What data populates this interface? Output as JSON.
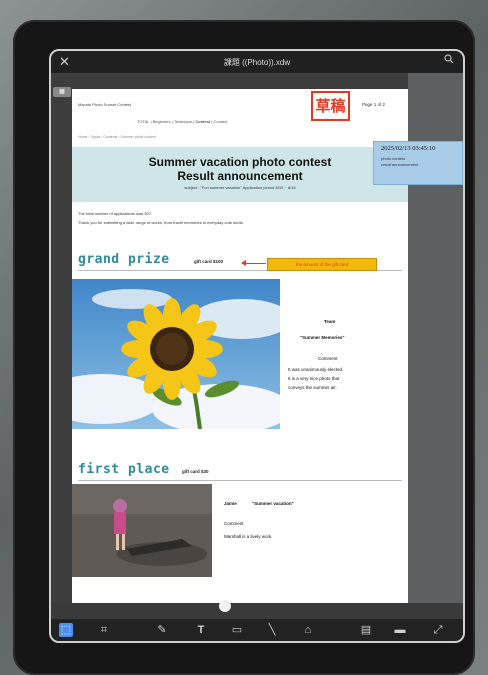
{
  "window": {
    "title": "課題 ((Photo)).xdw"
  },
  "sidebar_tab": "",
  "doc": {
    "header_small": "Macato Photo Sunset Contest",
    "stamp_text": "草稿",
    "page_indicator": "Page 1 of 2",
    "nav": [
      "TOTAL",
      "Beginners",
      "Technique",
      "Contest",
      "Contact"
    ],
    "breadcrumb": "Home › Topics › Contents › Summer photo contest",
    "title_line1": "Summer vacation photo contest",
    "title_line2": "Result announcement",
    "subtitle": "subject : \"Fun summer vacation\" Application period 8/10 ~ 8/15",
    "intro1": "The total number of applications was 307.",
    "intro2": "Thank you for submitting a wide range of works, from travel memories to everyday cute shots.",
    "grand_prize": {
      "heading": "grand prize",
      "gift": "gift card $100",
      "callout": "the amount of the gift card",
      "winner": "Team",
      "work": "\"Summer Memories\"",
      "comment_label": "Comment",
      "comment": [
        "It was unanimously elected.",
        "It is a very nice photo that",
        "conveys the summer air."
      ]
    },
    "first_place": {
      "heading": "first place",
      "gift": "gift card $30",
      "winner": "Jamie",
      "work": "\"Summer vacation\"",
      "comment_label": "Comment",
      "comment": "Marshall is a lively work."
    }
  },
  "annotation": {
    "timestamp": "2025/02/13 03:45:10",
    "line1": "photo contest",
    "line2": "result announcement"
  },
  "colors": {
    "accent": "#2e8b9a",
    "stamp": "#e23a22",
    "callout": "#f1b90b",
    "banner": "#cfe6e8",
    "annotation": "#a9cde8"
  },
  "toolbar": {
    "tools": [
      "select-tool",
      "crop-tool",
      "pen-tool",
      "text-tool",
      "rectangle-tool",
      "line-tool",
      "stamp-tool",
      "page-tool",
      "fill-tool",
      "expand-tool"
    ]
  }
}
